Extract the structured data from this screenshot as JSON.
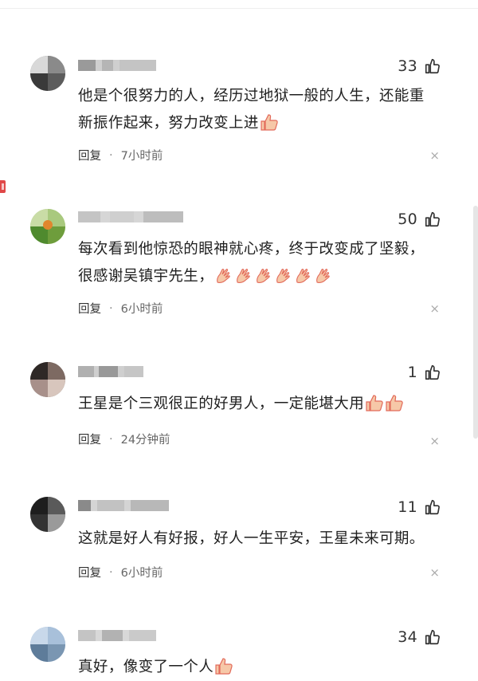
{
  "reply_label": "回复",
  "separator": "·",
  "close_glyph": "×",
  "comments": [
    {
      "likes": "33",
      "lines": [
        "他是个很努力的人，经历过地狱一般的人生，还能重",
        "新振作起来，努力改变上进"
      ],
      "emojis": [
        "thumbs-up"
      ],
      "time": "7小时前"
    },
    {
      "likes": "50",
      "lines": [
        "每次看到他惊恐的眼神就心疼，终于改变成了坚毅，",
        "很感谢吴镇宇先生，"
      ],
      "emojis": [
        "clap",
        "clap",
        "clap",
        "clap",
        "clap",
        "clap"
      ],
      "time": "6小时前"
    },
    {
      "likes": "1",
      "lines": [
        "王星是个三观很正的好男人，一定能堪大用"
      ],
      "emojis": [
        "thumbs-up",
        "thumbs-up"
      ],
      "time": "24分钟前"
    },
    {
      "likes": "11",
      "lines": [
        "这就是好人有好报，好人一生平安，王星未来可期。"
      ],
      "emojis": [],
      "time": "6小时前"
    },
    {
      "likes": "34",
      "lines": [
        "真好，像变了一个人"
      ],
      "emojis": [
        "thumbs-up"
      ],
      "time": ""
    }
  ]
}
